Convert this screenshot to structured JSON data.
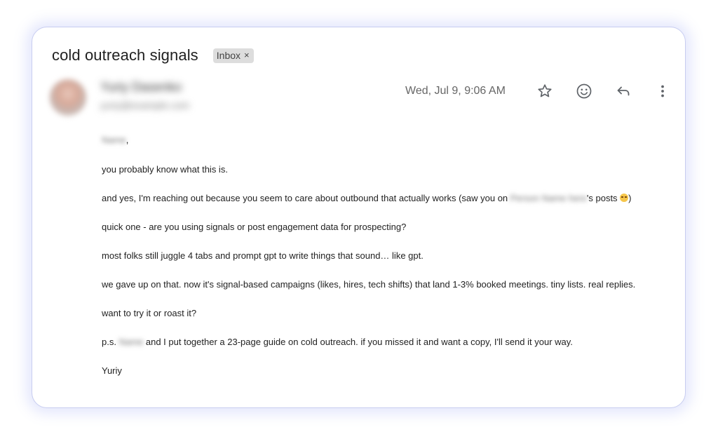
{
  "email": {
    "subject": "cold outreach signals",
    "label": "Inbox",
    "label_remove": "×",
    "sender": {
      "name": "Yuriy Dasenko",
      "email": "yuriy@example.com"
    },
    "date": "Wed, Jul 9, 9:06 AM",
    "actions": [
      "star-icon",
      "emoji-react-icon",
      "reply-icon",
      "more-vert-icon"
    ]
  },
  "body": {
    "greeting_name": "Name",
    "greeting_suffix": ",",
    "line1": "you probably know what this is.",
    "line2_before": "and yes, I'm reaching out because you seem to care about outbound that actually works (saw you on ",
    "line2_blurred": "Person Name here",
    "line2_after": "'s posts ",
    "line2_end": ")",
    "line3": "quick one - are you using signals or post engagement data for prospecting?",
    "line4": "most folks still juggle 4 tabs and prompt gpt to write things that sound… like gpt.",
    "line5": "we gave up on that. now it's signal-based campaigns (likes, hires, tech shifts) that land 1-3% booked meetings. tiny lists. real replies.",
    "line6": "want to try it or roast it?",
    "line7_before": "p.s. ",
    "line7_blurred": "Name",
    "line7_after": " and I put together a 23-page guide on cold outreach. if you missed it and want a copy, I'll send it your way.",
    "signature": "Yuriy"
  },
  "colors": {
    "card_border": "#c8cdf0",
    "chip_bg": "#dddddd",
    "icon_gray": "#5f6368",
    "date_gray": "#666666"
  }
}
